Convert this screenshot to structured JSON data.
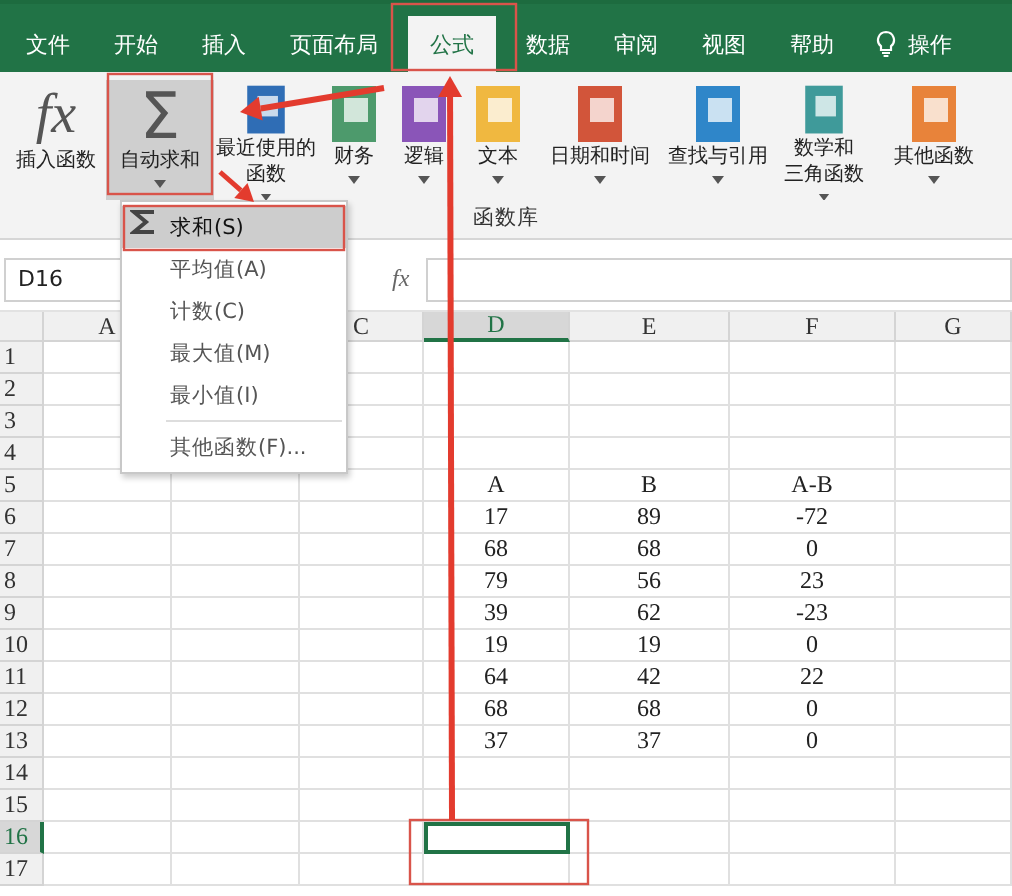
{
  "tabs": [
    {
      "label": "文件",
      "selected": false
    },
    {
      "label": "开始",
      "selected": false
    },
    {
      "label": "插入",
      "selected": false
    },
    {
      "label": "页面布局",
      "selected": false
    },
    {
      "label": "公式",
      "selected": true
    },
    {
      "label": "数据",
      "selected": false
    },
    {
      "label": "审阅",
      "selected": false
    },
    {
      "label": "视图",
      "selected": false
    },
    {
      "label": "帮助",
      "selected": false
    }
  ],
  "tell_me": {
    "label": "操作"
  },
  "ribbon": {
    "group_label": "函数库",
    "buttons": [
      {
        "label": "插入函数",
        "kind": "glyph",
        "glyph": "fx",
        "dropdown": false,
        "selected": false
      },
      {
        "label": "自动求和",
        "kind": "glyph",
        "glyph": "Σ",
        "dropdown": true,
        "selected": true
      },
      {
        "label_lines": [
          "最近使用的",
          "函数"
        ],
        "kind": "book",
        "color": "#2f6db5",
        "dropdown": true,
        "selected": false
      },
      {
        "label": "财务",
        "kind": "book",
        "color": "#4d9a6c",
        "dropdown": true,
        "selected": false
      },
      {
        "label": "逻辑",
        "kind": "book",
        "color": "#8a55b8",
        "dropdown": true,
        "selected": false
      },
      {
        "label": "文本",
        "kind": "book",
        "color": "#f0b840",
        "dropdown": true,
        "selected": false
      },
      {
        "label": "日期和时间",
        "kind": "book",
        "color": "#d2553a",
        "dropdown": true,
        "selected": false
      },
      {
        "label": "查找与引用",
        "kind": "book",
        "color": "#2f86c9",
        "dropdown": true,
        "selected": false
      },
      {
        "label_lines": [
          "数学和",
          "三角函数"
        ],
        "kind": "book",
        "color": "#3f9a9a",
        "dropdown": true,
        "selected": false
      },
      {
        "label": "其他函数",
        "kind": "book",
        "color": "#e8833a",
        "dropdown": true,
        "selected": false
      }
    ]
  },
  "autosum_menu": [
    {
      "label": "求和(S)",
      "kind": "sum",
      "selected": true,
      "separator_before": false
    },
    {
      "label": "平均值(A)",
      "kind": "plain",
      "selected": false,
      "separator_before": false
    },
    {
      "label": "计数(C)",
      "kind": "plain",
      "selected": false,
      "separator_before": false
    },
    {
      "label": "最大值(M)",
      "kind": "plain",
      "selected": false,
      "separator_before": false
    },
    {
      "label": "最小值(I)",
      "kind": "plain",
      "selected": false,
      "separator_before": false
    },
    {
      "label": "其他函数(F)...",
      "kind": "plain",
      "selected": false,
      "separator_before": true
    }
  ],
  "formula_bar": {
    "name_box": "D16",
    "function_label": "fx"
  },
  "sheet": {
    "columns": [
      {
        "label": "A",
        "selected": false
      },
      {},
      {
        "label": "C",
        "selected": false
      },
      {
        "label": "D",
        "selected": true
      },
      {
        "label": "E",
        "selected": false
      },
      {
        "label": "F",
        "selected": false
      },
      {
        "label": "G",
        "selected": false
      }
    ],
    "rows": [
      {
        "header": "1",
        "selected": false
      },
      {
        "header": "2",
        "selected": false
      },
      {
        "header": "3",
        "selected": false
      },
      {
        "header": "4",
        "selected": false
      },
      {
        "header": "5",
        "selected": false,
        "D": "A",
        "E": "B",
        "F": "A-B"
      },
      {
        "header": "6",
        "selected": false,
        "D": "17",
        "E": "89",
        "F": "-72"
      },
      {
        "header": "7",
        "selected": false,
        "D": "68",
        "E": "68",
        "F": "0"
      },
      {
        "header": "8",
        "selected": false,
        "D": "79",
        "E": "56",
        "F": "23"
      },
      {
        "header": "9",
        "selected": false,
        "D": "39",
        "E": "62",
        "F": "-23"
      },
      {
        "header": "10",
        "selected": false,
        "D": "19",
        "E": "19",
        "F": "0"
      },
      {
        "header": "11",
        "selected": false,
        "D": "64",
        "E": "42",
        "F": "22"
      },
      {
        "header": "12",
        "selected": false,
        "D": "68",
        "E": "68",
        "F": "0"
      },
      {
        "header": "13",
        "selected": false,
        "D": "37",
        "E": "37",
        "F": "0"
      },
      {
        "header": "14",
        "selected": false
      },
      {
        "header": "15",
        "selected": false
      },
      {
        "header": "16",
        "selected": true
      },
      {
        "header": "17",
        "selected": false
      }
    ]
  }
}
